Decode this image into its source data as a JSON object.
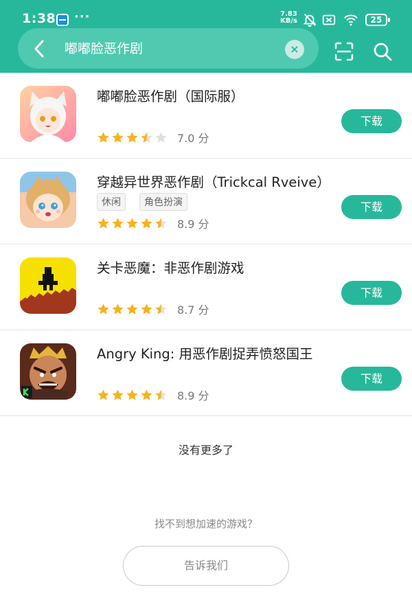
{
  "status_bar": {
    "time": "1:38",
    "dots": "···",
    "speed_value": "7.83",
    "speed_unit": "KB/s",
    "battery": "25"
  },
  "search": {
    "query": "嘟嘟脸恶作剧",
    "clear_symbol": "×"
  },
  "results": [
    {
      "title": "嘟嘟脸恶作剧（国际服）",
      "tags": [],
      "rating_stars": 3.5,
      "score": "7.0 分",
      "button": "下载",
      "icon": "cartoon-girl-icon"
    },
    {
      "title": "穿越异世界恶作剧（Trickcal Rveive）",
      "tags": [
        "休闲",
        "角色扮演"
      ],
      "rating_stars": 4.5,
      "score": "8.9 分",
      "button": "下载",
      "icon": "chibi-character-icon"
    },
    {
      "title": "关卡恶魔：非恶作剧游戏",
      "tags": [],
      "rating_stars": 4.5,
      "score": "8.7 分",
      "button": "下载",
      "icon": "pixel-figure-icon"
    },
    {
      "title": "Angry King: 用恶作剧捉弄愤怒国王",
      "tags": [],
      "rating_stars": 4.5,
      "score": "8.9 分",
      "button": "下载",
      "icon": "angry-king-icon"
    }
  ],
  "footer": {
    "no_more": "没有更多了",
    "cant_find": "找不到想加速的游戏？",
    "tell_us": "告诉我们"
  },
  "colors": {
    "accent": "#27b89b",
    "star": "#f7b21b",
    "star_empty": "#e0e0e0"
  }
}
